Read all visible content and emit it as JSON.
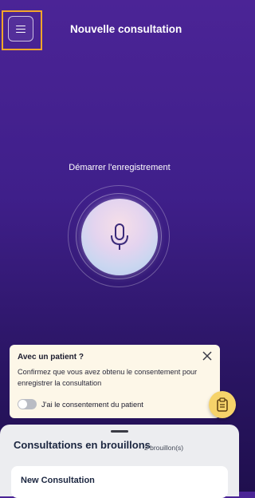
{
  "header": {
    "title": "Nouvelle consultation",
    "menu_icon": "hamburger-menu-icon",
    "highlight_color": "#f4a62a"
  },
  "recorder": {
    "label": "Démarrer l'enregistrement",
    "mic_icon": "microphone-icon"
  },
  "consent": {
    "title": "Avec un patient ?",
    "body": "Confirmez que vous avez obtenu le consentement pour enregistrer la consultation",
    "toggle_label": "J'ai le consentement du patient",
    "toggle_on": false
  },
  "fab": {
    "icon": "clipboard-icon",
    "color": "#f6d36a"
  },
  "drafts": {
    "title": "Consultations en brouillons",
    "count": "2 brouillon(s)",
    "items": [
      {
        "title": "New Consultation"
      }
    ]
  },
  "colors": {
    "background_top": "#4b2496",
    "background_bottom": "#1f0f4e",
    "card": "#fdf7e8"
  }
}
